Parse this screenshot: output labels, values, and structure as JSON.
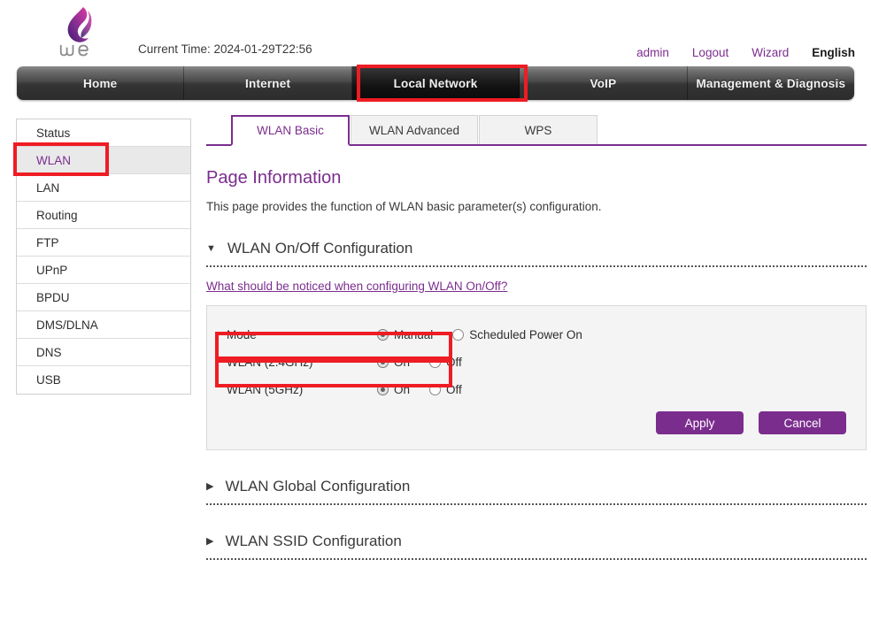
{
  "header": {
    "logo_name": "we-logo",
    "logo_wordmark": "we",
    "current_time": "Current Time: 2024-01-29T22:56",
    "links": [
      {
        "label": "admin",
        "name": "username-link"
      },
      {
        "label": "Logout",
        "name": "logout-link"
      },
      {
        "label": "Wizard",
        "name": "wizard-link"
      }
    ],
    "language": "English"
  },
  "topnav": {
    "items": [
      {
        "label": "Home",
        "active": false
      },
      {
        "label": "Internet",
        "active": false
      },
      {
        "label": "Local Network",
        "active": true
      },
      {
        "label": "VoIP",
        "active": false
      },
      {
        "label": "Management & Diagnosis",
        "active": false
      }
    ]
  },
  "sidebar": {
    "items": [
      {
        "label": "Status",
        "active": false
      },
      {
        "label": "WLAN",
        "active": true
      },
      {
        "label": "LAN",
        "active": false
      },
      {
        "label": "Routing",
        "active": false
      },
      {
        "label": "FTP",
        "active": false
      },
      {
        "label": "UPnP",
        "active": false
      },
      {
        "label": "BPDU",
        "active": false
      },
      {
        "label": "DMS/DLNA",
        "active": false
      },
      {
        "label": "DNS",
        "active": false
      },
      {
        "label": "USB",
        "active": false
      }
    ]
  },
  "tabs": [
    {
      "label": "WLAN Basic",
      "active": true
    },
    {
      "label": "WLAN Advanced",
      "active": false
    },
    {
      "label": "WPS",
      "active": false
    }
  ],
  "page": {
    "title": "Page Information",
    "description": "This page provides the function of WLAN basic parameter(s) configuration."
  },
  "onoff_section": {
    "title": "WLAN On/Off Configuration",
    "expanded_icon": "▼",
    "notice_link": "What should be noticed when configuring WLAN On/Off?",
    "rows": [
      {
        "label": "Mode",
        "options": [
          {
            "label": "Manual",
            "selected": true
          },
          {
            "label": "Scheduled Power On",
            "selected": false
          }
        ]
      },
      {
        "label": "WLAN (2.4GHz)",
        "options": [
          {
            "label": "On",
            "selected": true
          },
          {
            "label": "Off",
            "selected": false
          }
        ]
      },
      {
        "label": "WLAN (5GHz)",
        "options": [
          {
            "label": "On",
            "selected": true
          },
          {
            "label": "Off",
            "selected": false
          }
        ]
      }
    ],
    "apply_label": "Apply",
    "cancel_label": "Cancel"
  },
  "collapsed_sections": [
    {
      "title": "WLAN Global Configuration",
      "icon": "▶"
    },
    {
      "title": "WLAN SSID Configuration",
      "icon": "▶"
    }
  ],
  "colors": {
    "brand_purple": "#7b2d8e",
    "annotation_red": "#ee1c23",
    "nav_dark": "#2c2c2c",
    "panel_grey": "#f4f4f4"
  }
}
